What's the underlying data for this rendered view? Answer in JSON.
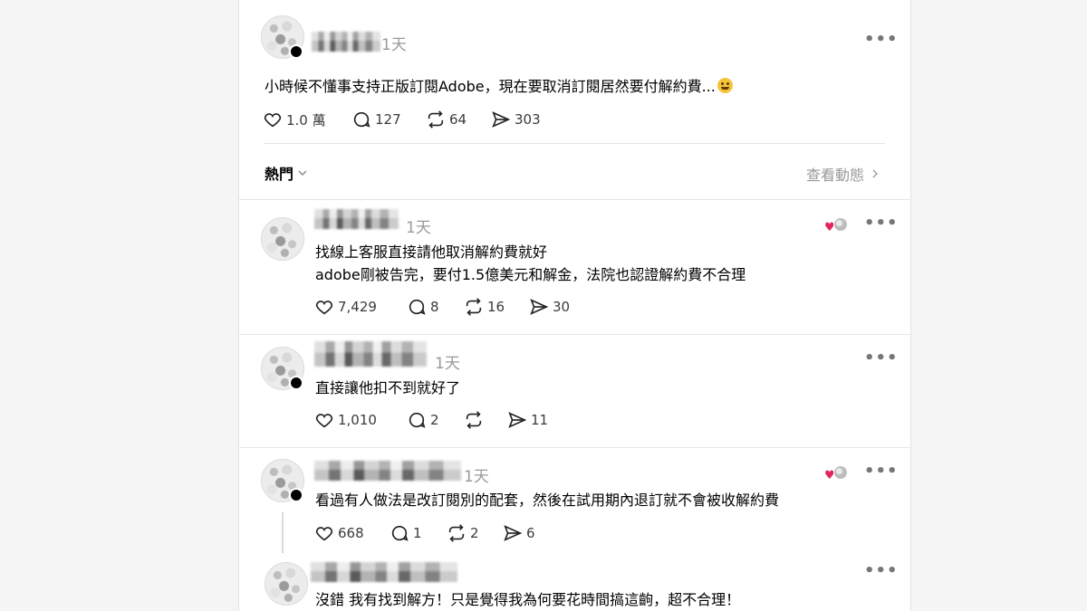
{
  "post": {
    "time": "1天",
    "text": "小時候不懂事支持正版訂閱Adobe，現在要取消訂閱居然要付解約費...",
    "emoji_icon": "melting-face-emoji",
    "likes": "1.0 萬",
    "replies": "127",
    "reposts": "64",
    "shares": "303"
  },
  "sort": {
    "label": "熱門",
    "activity_link": "查看動態"
  },
  "comments": [
    {
      "time": "1天",
      "line1": "找線上客服直接請他取消解約費就好",
      "line2": "adobe剛被告完，要付1.5億美元和解金，法院也認證解約費不合理",
      "likes": "7,429",
      "replies": "8",
      "reposts": "16",
      "shares": "30",
      "liked_by_author": true
    },
    {
      "time": "1天",
      "line1": "直接讓他扣不到就好了",
      "likes": "1,010",
      "replies": "2",
      "reposts": "",
      "shares": "11",
      "liked_by_author": false
    },
    {
      "time": "1天",
      "line1": "看過有人做法是改訂閱別的配套，然後在試用期內退訂就不會被收解約費",
      "likes": "668",
      "replies": "1",
      "reposts": "2",
      "shares": "6",
      "liked_by_author": true
    },
    {
      "time": "",
      "line1": "沒錯 我有找到解方！只是覺得我為何要花時間搞這齣，超不合理！"
    }
  ],
  "icons": {
    "like": "heart-icon",
    "reply": "comment-icon",
    "repost": "repost-icon",
    "share": "share-icon",
    "more": "more-icon",
    "chevron": "chevron-down-icon",
    "arrow": "chevron-right-icon"
  },
  "colors": {
    "text": "#000000",
    "muted": "#999999",
    "accent_heart": "#e0245e"
  }
}
